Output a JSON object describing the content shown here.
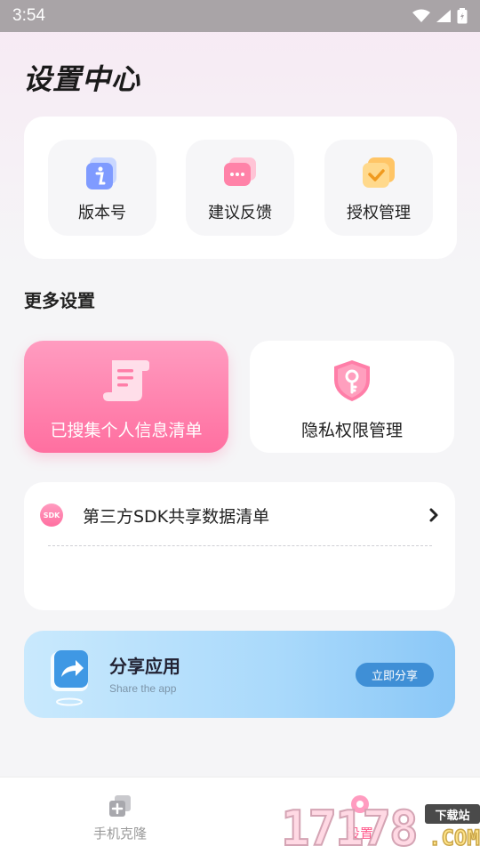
{
  "status_bar": {
    "time": "3:54",
    "icons": [
      "wifi-icon",
      "signal-icon",
      "battery-icon"
    ]
  },
  "page": {
    "title": "设置中心"
  },
  "top_actions": [
    {
      "label": "版本号",
      "icon": "info-icon"
    },
    {
      "label": "建议反馈",
      "icon": "chat-icon"
    },
    {
      "label": "授权管理",
      "icon": "check-icon"
    }
  ],
  "more_settings": {
    "title": "更多设置",
    "collected_info": {
      "label": "已搜集个人信息清单",
      "icon": "document-icon"
    },
    "privacy": {
      "label": "隐私权限管理",
      "icon": "shield-key-icon"
    },
    "sdk": {
      "badge": "SDK",
      "label": "第三方SDK共享数据清单"
    }
  },
  "share": {
    "title": "分享应用",
    "subtitle": "Share the app",
    "button": "立即分享"
  },
  "tabbar": {
    "items": [
      {
        "label": "手机克隆",
        "icon": "add-square-icon",
        "active": false
      },
      {
        "label": "设置",
        "icon": "settings-icon",
        "active": true
      }
    ]
  },
  "watermark": {
    "number": "17178",
    "tag": "下载站",
    "suffix": ".COM"
  },
  "colors": {
    "accent_pink": "#ff6fa0",
    "accent_blue": "#3f8fd6",
    "background": "#f5f5f7"
  }
}
